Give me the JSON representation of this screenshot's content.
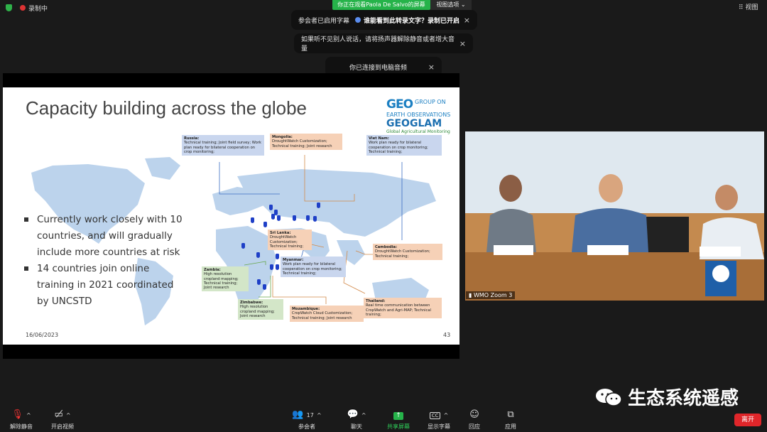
{
  "topbar": {
    "recording": "录制中",
    "viewing_banner": "你正在观看Paola De Salvo的屏幕",
    "view_options": "视图选项",
    "view": "视图"
  },
  "notifications": [
    {
      "text": "参会者已启用字幕",
      "highlight": "谁能看到此转录文字？录制已开启",
      "close": "×"
    },
    {
      "text": "如果听不见别人说话，请将扬声器解除静音或者增大音量",
      "close": "×"
    },
    {
      "text": "你已连接到电脑音频",
      "close": "×"
    }
  ],
  "slide": {
    "title": "Capacity building across the globe",
    "logo": {
      "mark": "GEO",
      "line1": "GROUP ON",
      "line2": "EARTH OBSERVATIONS",
      "geoglam": "GEOGLAM",
      "gam": "Global Agricultural Monitoring"
    },
    "bullets": [
      "Currently work closely with 10 countries, and will gradually include more countries at risk",
      "14 countries join online training in 2021 coordinated by UNCSTD"
    ],
    "date": "16/06/2023",
    "page": "43",
    "callouts": {
      "russia": {
        "name": "Russia:",
        "text": "Technical training; Joint field survey; Work plan ready for bilateral cooperation on crop monitoring;"
      },
      "mongolia": {
        "name": "Mongolia:",
        "text": "DroughtWatch Customization; Technical training; Joint research"
      },
      "vietnam": {
        "name": "Viet Nam:",
        "text": "Work plan ready for bilateral cooperation on crop monitoring; Technical training;"
      },
      "srilanka": {
        "name": "Sri Lanka:",
        "text": "DroughtWatch Customization; Technical training;"
      },
      "cambodia": {
        "name": "Cambodia:",
        "text": "DroughtWatch Customization; Technical training;"
      },
      "myanmar": {
        "name": "Myanmar:",
        "text": "Work plan ready for bilateral cooperation on crop monitoring; Technical training;"
      },
      "zambia": {
        "name": "Zambia:",
        "text": "High resolution cropland mapping; Technical training; Joint research"
      },
      "zimbabwe": {
        "name": "Zimbabwe:",
        "text": "High resolution cropland mapping; Joint research"
      },
      "mozambique": {
        "name": "Mozambique:",
        "text": "CropWatch Cloud Customization; Technical training; Joint research"
      },
      "thailand": {
        "name": "Thailand:",
        "text": "Real time communication between CropWatch and Agri-MAP; Technical training;"
      }
    }
  },
  "video": {
    "label": "WMO Zoom 3",
    "nameplates": [
      "Felipe Carlos GEO Secretariat",
      "Miao Zhang Chinese Academy of Sciences",
      "Herve Kerdiles Joint Research Centre"
    ],
    "org": "WMO"
  },
  "watermark": "生态系统遥感",
  "toolbar": {
    "mute": "解除静音",
    "video": "开启视频",
    "participants": "参会者",
    "participants_count": "17",
    "chat": "聊天",
    "share": "共享屏幕",
    "captions": "显示字幕",
    "reactions": "回应",
    "apps": "应用",
    "leave": "离开"
  },
  "colors": {
    "share_green": "#26b34a",
    "leave_red": "#e0262a",
    "callout_blue": "#c9d6ee",
    "callout_orange": "#f6d1b7",
    "callout_green": "#d3e6c8"
  }
}
